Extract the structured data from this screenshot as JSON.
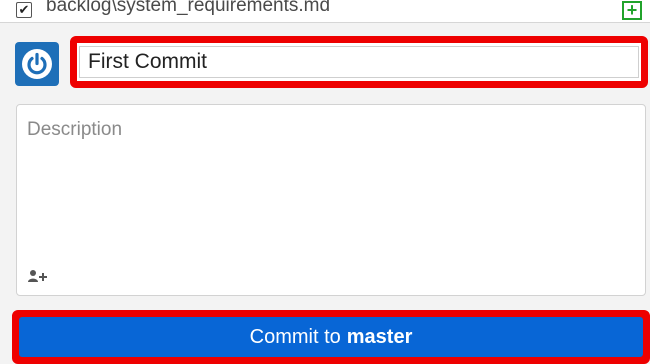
{
  "changes": {
    "file_path": "backlog\\system_requirements.md",
    "checked": true,
    "status_icon": "plus-icon"
  },
  "avatar": {
    "icon": "power-icon",
    "color": "#1e6fb8"
  },
  "summary": {
    "value": "First Commit"
  },
  "description": {
    "placeholder": "Description",
    "value": ""
  },
  "coauthor": {
    "icon": "add-person-icon"
  },
  "commit": {
    "prefix": "Commit to",
    "branch": "master",
    "color": "#0866d6"
  },
  "highlight": {
    "color": "#ee0000"
  }
}
